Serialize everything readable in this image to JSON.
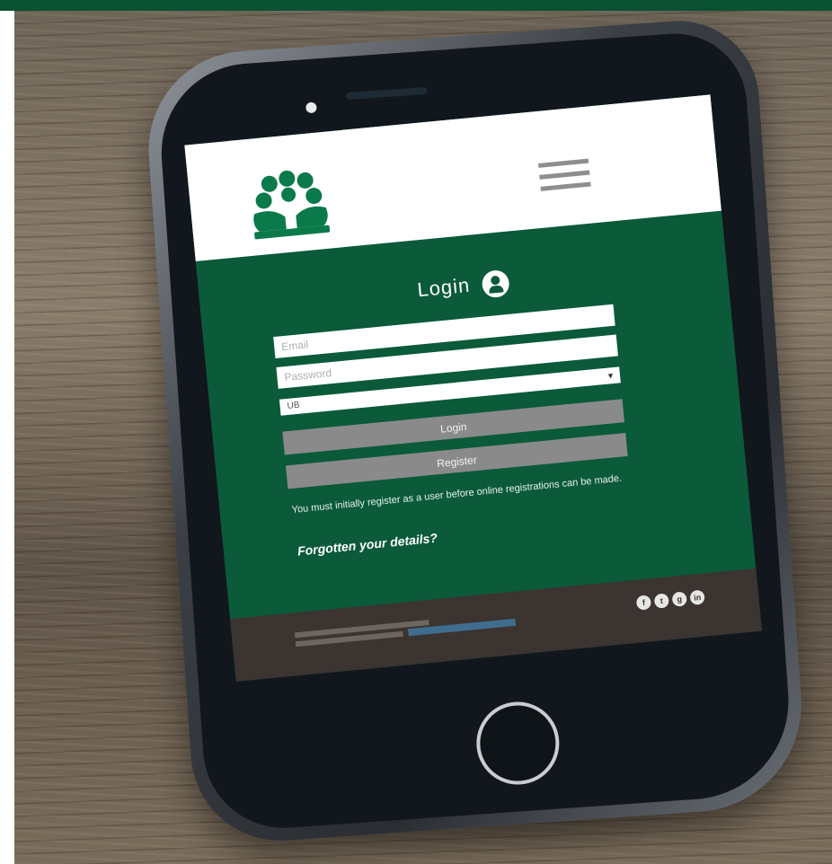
{
  "login": {
    "title": "Login",
    "email_placeholder": "Email",
    "password_placeholder": "Password",
    "select_value": "UB",
    "login_button": "Login",
    "register_button": "Register",
    "notice": "You must initially register as a user before online registrations can be made.",
    "forgotten_link": "Forgotten your details?"
  },
  "social": [
    "f",
    "t",
    "g",
    "in"
  ],
  "colors": {
    "brand_green": "#0b5a3a",
    "button_grey": "#8a8a8a",
    "footer": "#3b3430"
  }
}
